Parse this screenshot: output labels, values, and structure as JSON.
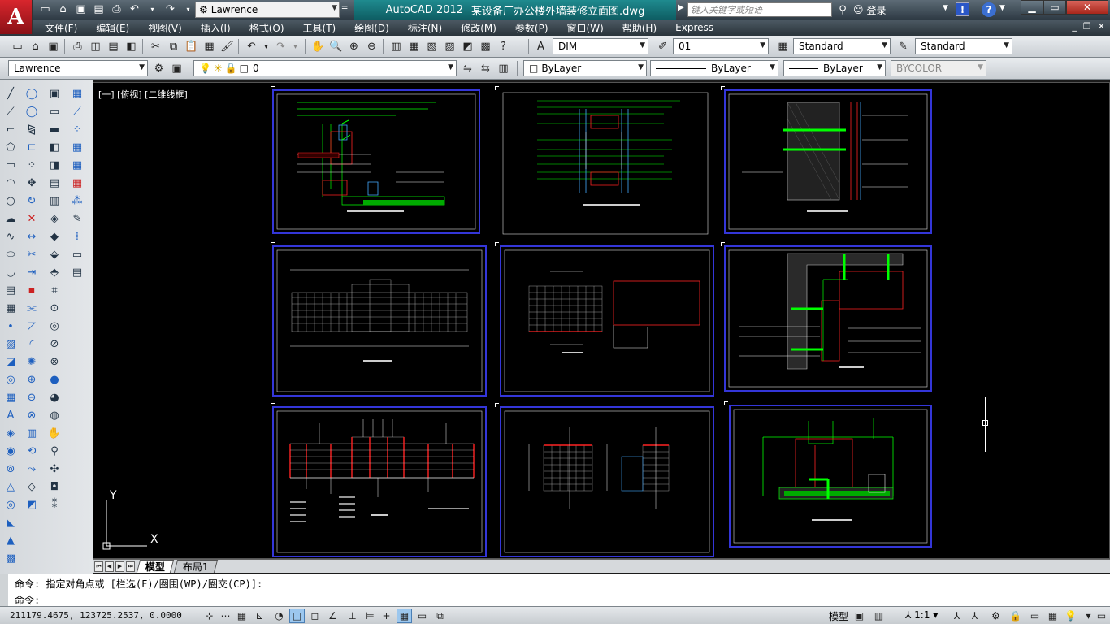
{
  "app": {
    "logo_letter": "A"
  },
  "titlebar": {
    "workspace": "Lawrence",
    "app_name": "AutoCAD 2012",
    "document": "某设备厂办公楼外墙装修立面图.dwg",
    "search_placeholder": "键入关键字或短语",
    "login_label": "登录"
  },
  "menu": {
    "items": [
      "文件(F)",
      "编辑(E)",
      "视图(V)",
      "插入(I)",
      "格式(O)",
      "工具(T)",
      "绘图(D)",
      "标注(N)",
      "修改(M)",
      "参数(P)",
      "窗口(W)",
      "帮助(H)",
      "Express"
    ]
  },
  "toolbar": {
    "dimstyle": "DIM",
    "textheight": "01",
    "tablestyle": "Standard",
    "multileader": "Standard",
    "workspace2": "Lawrence",
    "layer": "0",
    "color": "ByLayer",
    "linetype": "ByLayer",
    "lineweight": "ByLayer",
    "plotstyle": "BYCOLOR"
  },
  "canvas": {
    "view_label": "[一] [俯视] [二维线框]",
    "ucs_x": "X",
    "ucs_y": "Y"
  },
  "tabs": {
    "model": "模型",
    "layout": "布局1"
  },
  "command": {
    "history": "命令: 指定对角点或 [栏选(F)/圈围(WP)/圈交(CP)]:",
    "prompt": "命令:"
  },
  "statusbar": {
    "coordinates": "211179.4675, 123725.2537, 0.0000",
    "model": "模型",
    "scale": "1:1"
  },
  "colors": {
    "canvas_bg": "#000000",
    "sheet_border": "#3436d9",
    "title_accent": "#1f8b8f"
  }
}
